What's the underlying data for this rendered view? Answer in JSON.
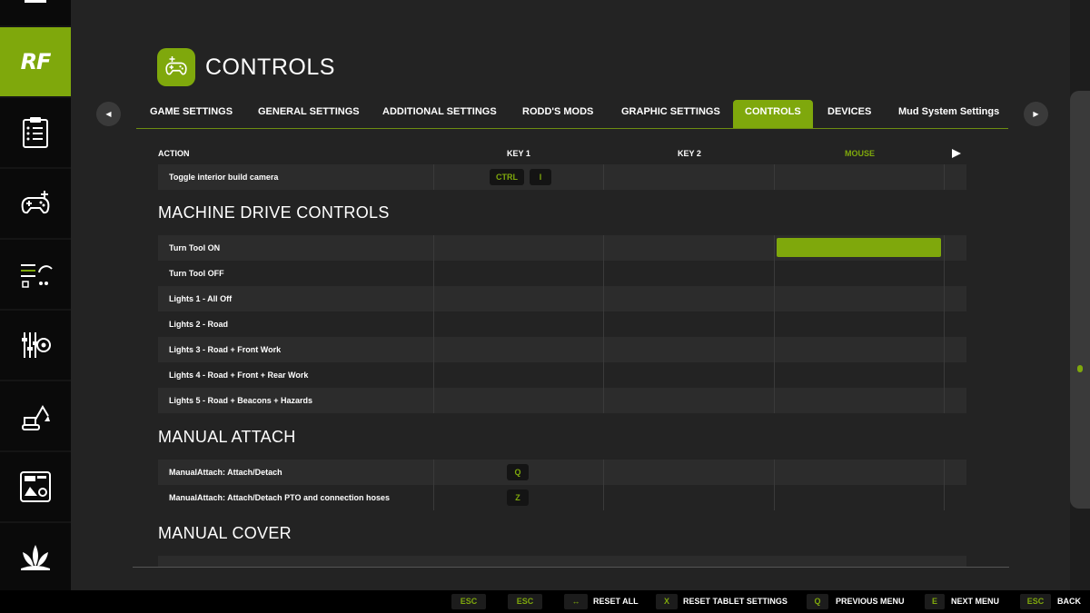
{
  "sidebar": {
    "logo_text": "RF",
    "items": [
      {
        "icon": "building-icon"
      },
      {
        "icon": "rf-logo",
        "active": true
      },
      {
        "icon": "clipboard-icon"
      },
      {
        "icon": "gamepad-icon"
      },
      {
        "icon": "sliders-gauge-icon"
      },
      {
        "icon": "settings-sliders-icon"
      },
      {
        "icon": "excavator-icon"
      },
      {
        "icon": "tablet-map-icon"
      },
      {
        "icon": "plant-icon"
      }
    ]
  },
  "header": {
    "title": "CONTROLS",
    "icon": "gamepad-icon"
  },
  "tabs": [
    {
      "label": "GAME SETTINGS"
    },
    {
      "label": "GENERAL SETTINGS"
    },
    {
      "label": "ADDITIONAL SETTINGS"
    },
    {
      "label": "RODD'S MODS"
    },
    {
      "label": "GRAPHIC SETTINGS"
    },
    {
      "label": "CONTROLS",
      "active": true
    },
    {
      "label": "DEVICES"
    },
    {
      "label": "Mud System Settings"
    }
  ],
  "columns": {
    "action": "ACTION",
    "key1": "KEY 1",
    "key2": "KEY 2",
    "mouse": "MOUSE"
  },
  "rows": {
    "r0": {
      "label": "Toggle interior build camera",
      "key1a": "CTRL",
      "key1b": "I"
    },
    "r1": {
      "label": "Turn Tool ON"
    },
    "r2": {
      "label": "Turn Tool OFF"
    },
    "r3": {
      "label": "Lights 1 - All Off"
    },
    "r4": {
      "label": "Lights 2 - Road"
    },
    "r5": {
      "label": "Lights 3 - Road + Front Work"
    },
    "r6": {
      "label": "Lights 4 - Road + Front + Rear Work"
    },
    "r7": {
      "label": "Lights 5 - Road + Beacons + Hazards"
    },
    "r8": {
      "label": "ManualAttach: Attach/Detach",
      "key1": "Q"
    },
    "r9": {
      "label": "ManualAttach: Attach/Detach PTO and connection hoses",
      "key1": "Z"
    }
  },
  "sections": {
    "machine": "MACHINE DRIVE CONTROLS",
    "attach": "MANUAL ATTACH",
    "cover": "MANUAL COVER"
  },
  "footer": {
    "esc1": "ESC",
    "esc2": "ESC",
    "reset_all_key": "↔",
    "reset_all": "RESET ALL",
    "reset_tablet_key": "X",
    "reset_tablet": "RESET TABLET SETTINGS",
    "prev_key": "Q",
    "prev": "PREVIOUS MENU",
    "next_key": "E",
    "next": "NEXT MENU",
    "back_key": "ESC",
    "back": "BACK"
  },
  "colors": {
    "accent": "#7fa80c",
    "background": "#232323",
    "sidebar": "#0a0a0a"
  }
}
